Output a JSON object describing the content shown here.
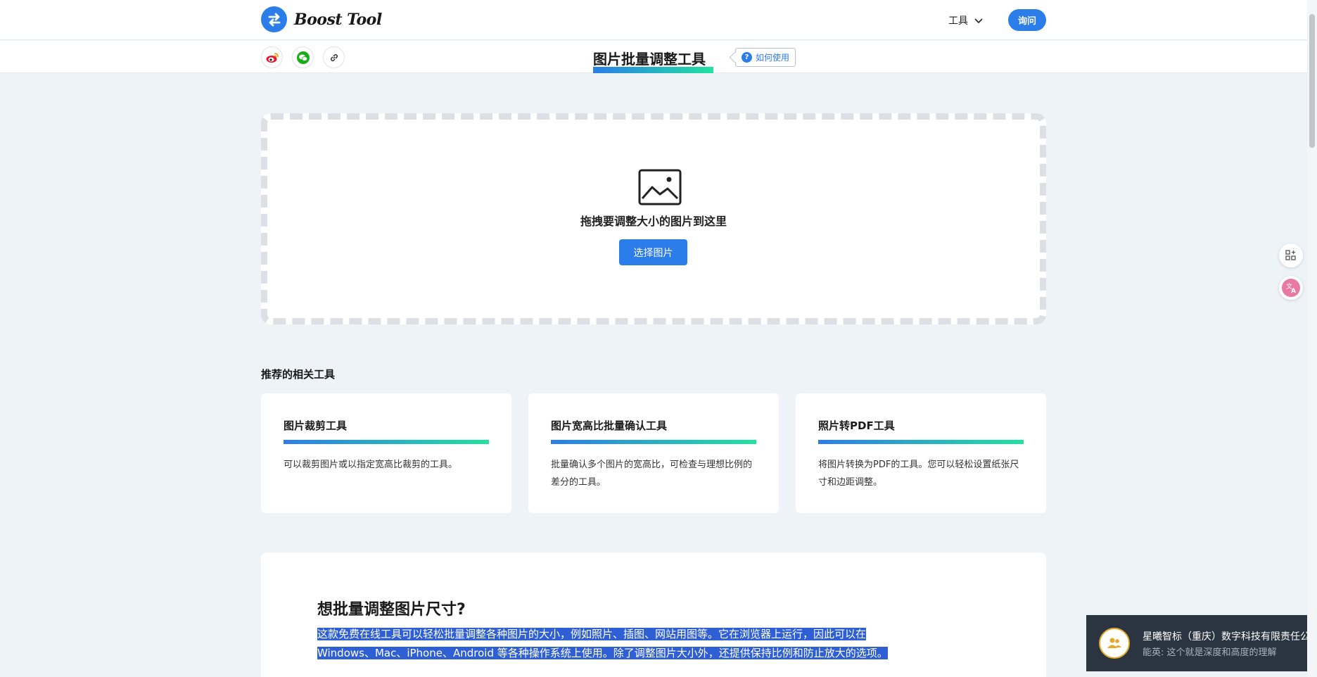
{
  "header": {
    "brand": "Boost Tool",
    "tools_label": "工具",
    "inquiry_label": "询问"
  },
  "subbar": {
    "title": "图片批量调整工具",
    "howto_label": "如何使用",
    "howto_icon": "?"
  },
  "dropzone": {
    "text": "拖拽要调整大小的图片到这里",
    "button": "选择图片"
  },
  "recommended": {
    "heading": "推荐的相关工具",
    "cards": [
      {
        "title": "图片裁剪工具",
        "desc": "可以裁剪图片或以指定宽高比裁剪的工具。"
      },
      {
        "title": "图片宽高比批量确认工具",
        "desc": "批量确认多个图片的宽高比，可检查与理想比例的差分的工具。"
      },
      {
        "title": "照片转PDF工具",
        "desc": "将图片转换为PDF的工具。您可以轻松设置纸张尺寸和边距调整。"
      }
    ]
  },
  "article": {
    "title": "想批量调整图片尺寸?",
    "line1": "这款免费在线工具可以轻松批量调整各种图片的大小，例如照片、插图、网站用图等。它在浏览器上运行，因此可以在",
    "line2": "Windows、Mac、iPhone、Android 等各种操作系统上使用。除了调整图片大小外，还提供保持比例和防止放大的选项。"
  },
  "notification": {
    "name": "星曦智标（重庆）数字科技有限责任公司",
    "message": "能英: 这个就是深度和高度的理解"
  },
  "colors": {
    "accent": "#2b7de9",
    "gradient_end": "#22e1a0",
    "background": "#eef3f7",
    "selection": "#2f5fd4"
  }
}
